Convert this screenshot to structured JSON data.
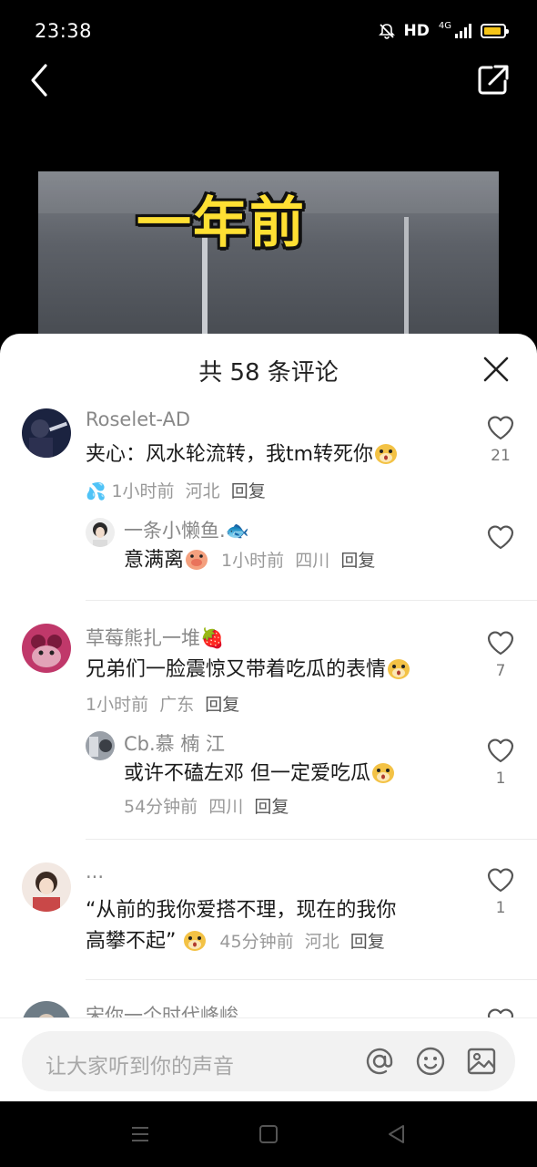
{
  "status": {
    "time": "23:38",
    "hd": "HD",
    "network": "4G",
    "battery_level": 0.9
  },
  "sheet": {
    "title": "共 58 条评论",
    "comments": [
      {
        "user": "Roselet-AD",
        "text": "夹心：风水轮流转，我tm转死你",
        "time": "1小时前",
        "location": "河北",
        "reply": "回复",
        "likes": "21"
      },
      {
        "user": "一条小懒鱼.",
        "text": "意满离",
        "time": "1小时前",
        "location": "四川",
        "reply": "回复"
      },
      {
        "user": "草莓熊扎一堆",
        "text": "兄弟们一脸震惊又带着吃瓜的表情",
        "time": "1小时前",
        "location": "广东",
        "reply": "回复",
        "likes": "7"
      },
      {
        "user": "Cb.慕 楠 江",
        "text": "或许不磕左邓 但一定爱吃瓜",
        "time": "54分钟前",
        "location": "四川",
        "reply": "回复",
        "likes": "1"
      },
      {
        "user": "...",
        "text_line1": "“从前的我你爱搭不理，现在的我你",
        "text_line2": "高攀不起”",
        "time": "45分钟前",
        "location": "河北",
        "reply": "回复",
        "likes": "1"
      },
      {
        "user": "宋你一个时代峰峻"
      }
    ]
  },
  "input": {
    "placeholder": "让大家听到你的声音"
  },
  "video": {
    "caption": "一年前"
  },
  "icons": {
    "back": "chevron-left-icon",
    "share": "share-icon",
    "close": "close-icon",
    "like": "heart-outline-icon",
    "mention": "at-icon",
    "emoji": "smiley-icon",
    "image": "image-icon"
  },
  "colors": {
    "caption": "#ffe033",
    "battery": "#f5c518"
  }
}
